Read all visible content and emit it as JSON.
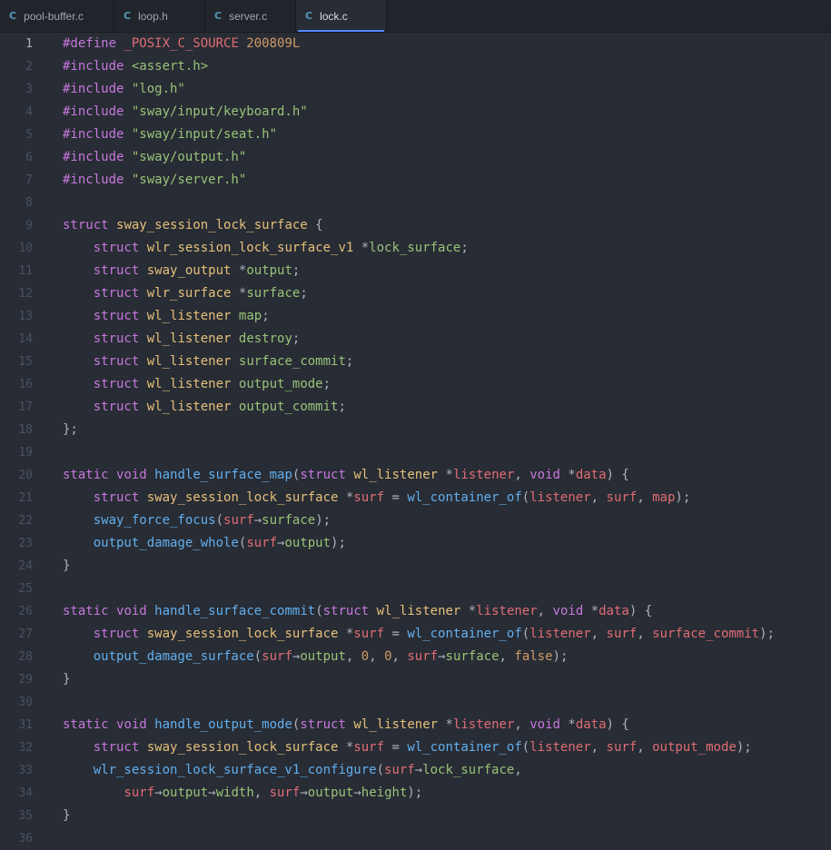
{
  "tabs": [
    {
      "icon": "C",
      "label": "pool-buffer.c",
      "active": false
    },
    {
      "icon": "C",
      "label": "loop.h",
      "active": false
    },
    {
      "icon": "C",
      "label": "server.c",
      "active": false
    },
    {
      "icon": "C",
      "label": "lock.c",
      "active": true
    }
  ],
  "editor": {
    "current_line": 1,
    "lines": [
      {
        "n": "1",
        "tokens": [
          [
            "kw",
            "#define "
          ],
          [
            "var",
            "_POSIX_C_SOURCE "
          ],
          [
            "num",
            "200809L"
          ]
        ]
      },
      {
        "n": "2",
        "tokens": [
          [
            "kw",
            "#include "
          ],
          [
            "str",
            "<assert.h>"
          ]
        ]
      },
      {
        "n": "3",
        "tokens": [
          [
            "kw",
            "#include "
          ],
          [
            "str",
            "\"log.h\""
          ]
        ]
      },
      {
        "n": "4",
        "tokens": [
          [
            "kw",
            "#include "
          ],
          [
            "str",
            "\"sway/input/keyboard.h\""
          ]
        ]
      },
      {
        "n": "5",
        "tokens": [
          [
            "kw",
            "#include "
          ],
          [
            "str",
            "\"sway/input/seat.h\""
          ]
        ]
      },
      {
        "n": "6",
        "tokens": [
          [
            "kw",
            "#include "
          ],
          [
            "str",
            "\"sway/output.h\""
          ]
        ]
      },
      {
        "n": "7",
        "tokens": [
          [
            "kw",
            "#include "
          ],
          [
            "str",
            "\"sway/server.h\""
          ]
        ]
      },
      {
        "n": "8",
        "tokens": []
      },
      {
        "n": "9",
        "tokens": [
          [
            "kw",
            "struct "
          ],
          [
            "mac",
            "sway_session_lock_surface "
          ],
          [
            "plain",
            "{"
          ]
        ]
      },
      {
        "n": "10",
        "tokens": [
          [
            "plain",
            "    "
          ],
          [
            "kw",
            "struct "
          ],
          [
            "mac",
            "wlr_session_lock_surface_v1 "
          ],
          [
            "plain",
            "*"
          ],
          [
            "str",
            "lock_surface"
          ],
          [
            "plain",
            ";"
          ]
        ]
      },
      {
        "n": "11",
        "tokens": [
          [
            "plain",
            "    "
          ],
          [
            "kw",
            "struct "
          ],
          [
            "mac",
            "sway_output "
          ],
          [
            "plain",
            "*"
          ],
          [
            "str",
            "output"
          ],
          [
            "plain",
            ";"
          ]
        ]
      },
      {
        "n": "12",
        "tokens": [
          [
            "plain",
            "    "
          ],
          [
            "kw",
            "struct "
          ],
          [
            "mac",
            "wlr_surface "
          ],
          [
            "plain",
            "*"
          ],
          [
            "str",
            "surface"
          ],
          [
            "plain",
            ";"
          ]
        ]
      },
      {
        "n": "13",
        "tokens": [
          [
            "plain",
            "    "
          ],
          [
            "kw",
            "struct "
          ],
          [
            "mac",
            "wl_listener "
          ],
          [
            "str",
            "map"
          ],
          [
            "plain",
            ";"
          ]
        ]
      },
      {
        "n": "14",
        "tokens": [
          [
            "plain",
            "    "
          ],
          [
            "kw",
            "struct "
          ],
          [
            "mac",
            "wl_listener "
          ],
          [
            "str",
            "destroy"
          ],
          [
            "plain",
            ";"
          ]
        ]
      },
      {
        "n": "15",
        "tokens": [
          [
            "plain",
            "    "
          ],
          [
            "kw",
            "struct "
          ],
          [
            "mac",
            "wl_listener "
          ],
          [
            "str",
            "surface_commit"
          ],
          [
            "plain",
            ";"
          ]
        ]
      },
      {
        "n": "16",
        "tokens": [
          [
            "plain",
            "    "
          ],
          [
            "kw",
            "struct "
          ],
          [
            "mac",
            "wl_listener "
          ],
          [
            "str",
            "output_mode"
          ],
          [
            "plain",
            ";"
          ]
        ]
      },
      {
        "n": "17",
        "tokens": [
          [
            "plain",
            "    "
          ],
          [
            "kw",
            "struct "
          ],
          [
            "mac",
            "wl_listener "
          ],
          [
            "str",
            "output_commit"
          ],
          [
            "plain",
            ";"
          ]
        ]
      },
      {
        "n": "18",
        "tokens": [
          [
            "plain",
            "};"
          ]
        ]
      },
      {
        "n": "19",
        "tokens": []
      },
      {
        "n": "20",
        "tokens": [
          [
            "kw",
            "static "
          ],
          [
            "kw",
            "void "
          ],
          [
            "fn",
            "handle_surface_map"
          ],
          [
            "plain",
            "("
          ],
          [
            "kw",
            "struct "
          ],
          [
            "mac",
            "wl_listener "
          ],
          [
            "plain",
            "*"
          ],
          [
            "var",
            "listener"
          ],
          [
            "plain",
            ", "
          ],
          [
            "kw",
            "void "
          ],
          [
            "plain",
            "*"
          ],
          [
            "var",
            "data"
          ],
          [
            "plain",
            ") {"
          ]
        ]
      },
      {
        "n": "21",
        "tokens": [
          [
            "plain",
            "    "
          ],
          [
            "kw",
            "struct "
          ],
          [
            "mac",
            "sway_session_lock_surface "
          ],
          [
            "plain",
            "*"
          ],
          [
            "var",
            "surf "
          ],
          [
            "plain",
            "= "
          ],
          [
            "fn",
            "wl_container_of"
          ],
          [
            "plain",
            "("
          ],
          [
            "var",
            "listener"
          ],
          [
            "plain",
            ", "
          ],
          [
            "var",
            "surf"
          ],
          [
            "plain",
            ", "
          ],
          [
            "var",
            "map"
          ],
          [
            "plain",
            ");"
          ]
        ]
      },
      {
        "n": "22",
        "tokens": [
          [
            "plain",
            "    "
          ],
          [
            "fn",
            "sway_force_focus"
          ],
          [
            "plain",
            "("
          ],
          [
            "var",
            "surf"
          ],
          [
            "plain",
            "→"
          ],
          [
            "str",
            "surface"
          ],
          [
            "plain",
            ");"
          ]
        ]
      },
      {
        "n": "23",
        "tokens": [
          [
            "plain",
            "    "
          ],
          [
            "fn",
            "output_damage_whole"
          ],
          [
            "plain",
            "("
          ],
          [
            "var",
            "surf"
          ],
          [
            "plain",
            "→"
          ],
          [
            "str",
            "output"
          ],
          [
            "plain",
            ");"
          ]
        ]
      },
      {
        "n": "24",
        "tokens": [
          [
            "plain",
            "}"
          ]
        ]
      },
      {
        "n": "25",
        "tokens": []
      },
      {
        "n": "26",
        "tokens": [
          [
            "kw",
            "static "
          ],
          [
            "kw",
            "void "
          ],
          [
            "fn",
            "handle_surface_commit"
          ],
          [
            "plain",
            "("
          ],
          [
            "kw",
            "struct "
          ],
          [
            "mac",
            "wl_listener "
          ],
          [
            "plain",
            "*"
          ],
          [
            "var",
            "listener"
          ],
          [
            "plain",
            ", "
          ],
          [
            "kw",
            "void "
          ],
          [
            "plain",
            "*"
          ],
          [
            "var",
            "data"
          ],
          [
            "plain",
            ") {"
          ]
        ]
      },
      {
        "n": "27",
        "tokens": [
          [
            "plain",
            "    "
          ],
          [
            "kw",
            "struct "
          ],
          [
            "mac",
            "sway_session_lock_surface "
          ],
          [
            "plain",
            "*"
          ],
          [
            "var",
            "surf "
          ],
          [
            "plain",
            "= "
          ],
          [
            "fn",
            "wl_container_of"
          ],
          [
            "plain",
            "("
          ],
          [
            "var",
            "listener"
          ],
          [
            "plain",
            ", "
          ],
          [
            "var",
            "surf"
          ],
          [
            "plain",
            ", "
          ],
          [
            "var",
            "surface_commit"
          ],
          [
            "plain",
            ");"
          ]
        ]
      },
      {
        "n": "28",
        "tokens": [
          [
            "plain",
            "    "
          ],
          [
            "fn",
            "output_damage_surface"
          ],
          [
            "plain",
            "("
          ],
          [
            "var",
            "surf"
          ],
          [
            "plain",
            "→"
          ],
          [
            "str",
            "output"
          ],
          [
            "plain",
            ", "
          ],
          [
            "num",
            "0"
          ],
          [
            "plain",
            ", "
          ],
          [
            "num",
            "0"
          ],
          [
            "plain",
            ", "
          ],
          [
            "var",
            "surf"
          ],
          [
            "plain",
            "→"
          ],
          [
            "str",
            "surface"
          ],
          [
            "plain",
            ", "
          ],
          [
            "num",
            "false"
          ],
          [
            "plain",
            ");"
          ]
        ]
      },
      {
        "n": "29",
        "tokens": [
          [
            "plain",
            "}"
          ]
        ]
      },
      {
        "n": "30",
        "tokens": []
      },
      {
        "n": "31",
        "tokens": [
          [
            "kw",
            "static "
          ],
          [
            "kw",
            "void "
          ],
          [
            "fn",
            "handle_output_mode"
          ],
          [
            "plain",
            "("
          ],
          [
            "kw",
            "struct "
          ],
          [
            "mac",
            "wl_listener "
          ],
          [
            "plain",
            "*"
          ],
          [
            "var",
            "listener"
          ],
          [
            "plain",
            ", "
          ],
          [
            "kw",
            "void "
          ],
          [
            "plain",
            "*"
          ],
          [
            "var",
            "data"
          ],
          [
            "plain",
            ") {"
          ]
        ]
      },
      {
        "n": "32",
        "tokens": [
          [
            "plain",
            "    "
          ],
          [
            "kw",
            "struct "
          ],
          [
            "mac",
            "sway_session_lock_surface "
          ],
          [
            "plain",
            "*"
          ],
          [
            "var",
            "surf "
          ],
          [
            "plain",
            "= "
          ],
          [
            "fn",
            "wl_container_of"
          ],
          [
            "plain",
            "("
          ],
          [
            "var",
            "listener"
          ],
          [
            "plain",
            ", "
          ],
          [
            "var",
            "surf"
          ],
          [
            "plain",
            ", "
          ],
          [
            "var",
            "output_mode"
          ],
          [
            "plain",
            ");"
          ]
        ]
      },
      {
        "n": "33",
        "tokens": [
          [
            "plain",
            "    "
          ],
          [
            "fn",
            "wlr_session_lock_surface_v1_configure"
          ],
          [
            "plain",
            "("
          ],
          [
            "var",
            "surf"
          ],
          [
            "plain",
            "→"
          ],
          [
            "str",
            "lock_surface"
          ],
          [
            "plain",
            ","
          ]
        ]
      },
      {
        "n": "34",
        "tokens": [
          [
            "plain",
            "        "
          ],
          [
            "var",
            "surf"
          ],
          [
            "plain",
            "→"
          ],
          [
            "str",
            "output"
          ],
          [
            "plain",
            "→"
          ],
          [
            "str",
            "width"
          ],
          [
            "plain",
            ", "
          ],
          [
            "var",
            "surf"
          ],
          [
            "plain",
            "→"
          ],
          [
            "str",
            "output"
          ],
          [
            "plain",
            "→"
          ],
          [
            "str",
            "height"
          ],
          [
            "plain",
            ");"
          ]
        ]
      },
      {
        "n": "35",
        "tokens": [
          [
            "plain",
            "}"
          ]
        ]
      },
      {
        "n": "36",
        "tokens": []
      }
    ]
  }
}
